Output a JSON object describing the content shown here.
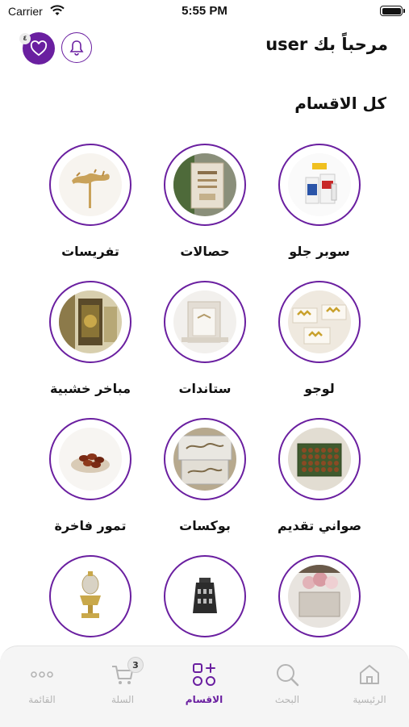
{
  "status_bar": {
    "carrier": "Carrier",
    "time": "5:55 PM"
  },
  "header": {
    "welcome": "مرحباً بك user",
    "favorites_count": "٤"
  },
  "section": {
    "title": "كل الاقسام"
  },
  "categories": [
    {
      "label": "سوبر جلو"
    },
    {
      "label": "حصالات"
    },
    {
      "label": "تفريسات"
    },
    {
      "label": "لوجو"
    },
    {
      "label": "ستاندات"
    },
    {
      "label": "مباخر خشبية"
    },
    {
      "label": "صواني تقديم"
    },
    {
      "label": "بوكسات"
    },
    {
      "label": "تمور فاخرة"
    },
    {
      "label": ""
    },
    {
      "label": ""
    },
    {
      "label": ""
    }
  ],
  "tabs": [
    {
      "label": "الرئيسية",
      "icon": "home-icon"
    },
    {
      "label": "البحث",
      "icon": "search-icon"
    },
    {
      "label": "الاقسام",
      "icon": "categories-icon",
      "active": true
    },
    {
      "label": "السلة",
      "icon": "cart-icon",
      "badge": "3"
    },
    {
      "label": "القائمة",
      "icon": "menu-dots-icon"
    }
  ],
  "colors": {
    "accent": "#6a1fa0",
    "inactive": "#b4b4b4"
  }
}
